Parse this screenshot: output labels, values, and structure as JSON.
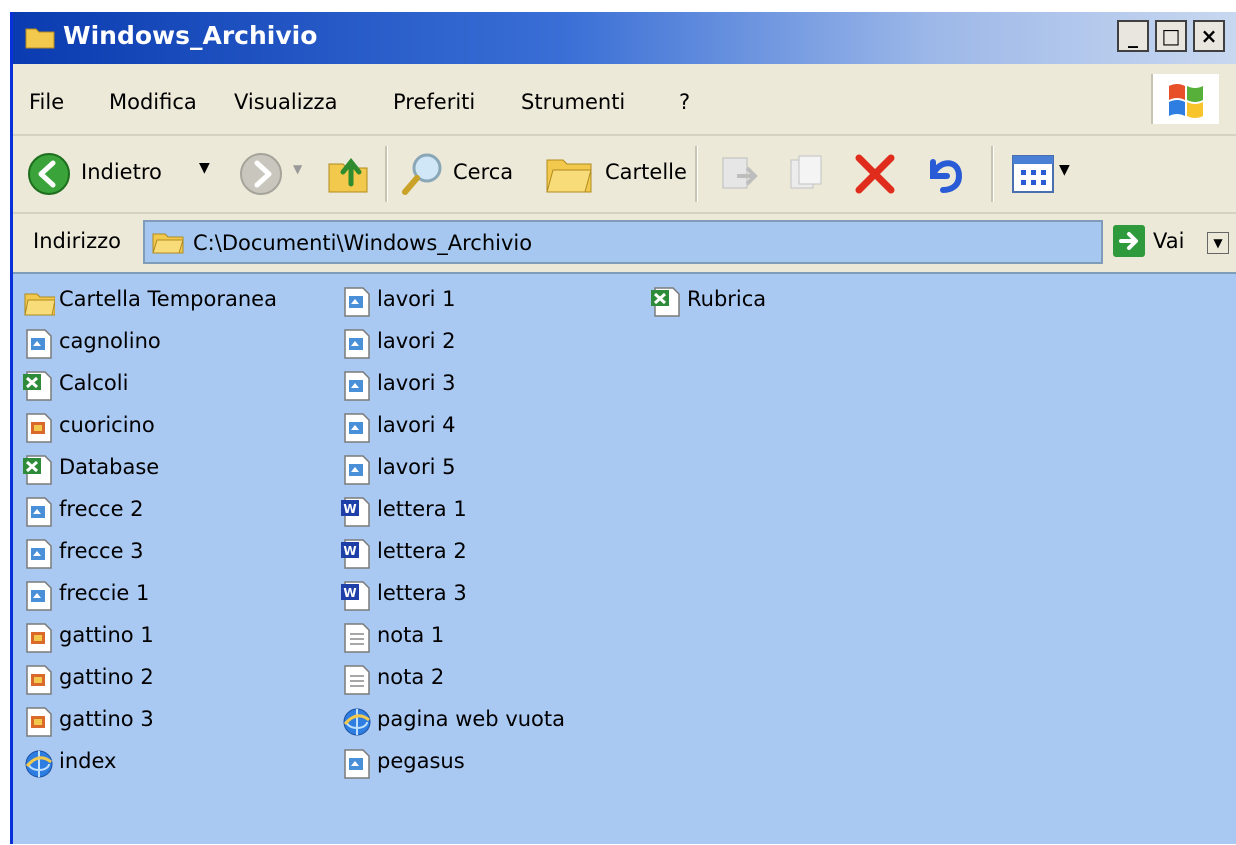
{
  "window": {
    "title": "Windows_Archivio",
    "controls": {
      "minimize": "_",
      "maximize": "□",
      "close": "×"
    }
  },
  "menu": [
    "File",
    "Modifica",
    "Visualizza",
    "Preferiti",
    "Strumenti",
    "?"
  ],
  "toolbar": {
    "back_label": "Indietro",
    "search_label": "Cerca",
    "folders_label": "Cartelle"
  },
  "address": {
    "label": "Indirizzo",
    "value": "C:\\Documenti\\Windows_Archivio",
    "go_label": "Vai"
  },
  "files": [
    {
      "name": "Cartella Temporanea",
      "type": "folder"
    },
    {
      "name": "cagnolino",
      "type": "paint"
    },
    {
      "name": "Calcoli",
      "type": "excel"
    },
    {
      "name": "cuoricino",
      "type": "image"
    },
    {
      "name": "Database",
      "type": "excel"
    },
    {
      "name": "frecce 2",
      "type": "paint"
    },
    {
      "name": "frecce 3",
      "type": "paint"
    },
    {
      "name": "freccie 1",
      "type": "paint"
    },
    {
      "name": "gattino 1",
      "type": "image"
    },
    {
      "name": "gattino 2",
      "type": "image"
    },
    {
      "name": "gattino 3",
      "type": "image"
    },
    {
      "name": "index",
      "type": "web"
    },
    {
      "name": "lavori 1",
      "type": "paint"
    },
    {
      "name": "lavori 2",
      "type": "paint"
    },
    {
      "name": "lavori 3",
      "type": "paint"
    },
    {
      "name": "lavori 4",
      "type": "paint"
    },
    {
      "name": "lavori 5",
      "type": "paint"
    },
    {
      "name": "lettera 1",
      "type": "word"
    },
    {
      "name": "lettera 2",
      "type": "word"
    },
    {
      "name": "lettera 3",
      "type": "word"
    },
    {
      "name": "nota 1",
      "type": "text"
    },
    {
      "name": "nota 2",
      "type": "text"
    },
    {
      "name": "pagina web vuota",
      "type": "web"
    },
    {
      "name": "pegasus",
      "type": "paint"
    },
    {
      "name": "Rubrica",
      "type": "excel"
    }
  ]
}
